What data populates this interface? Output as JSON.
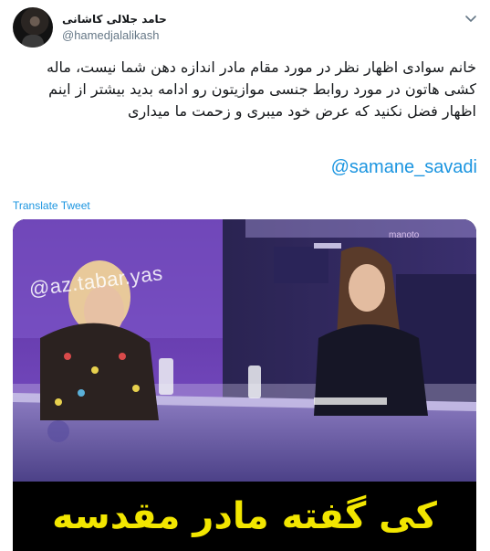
{
  "author": {
    "display_name": "حامد جلالی کاشانی",
    "handle": "@hamedjalalikash",
    "avatar_icon": "user-avatar"
  },
  "tweet": {
    "text": "خانم سوادی اظهار نظر در مورد مقام مادر اندازه دهن شما نیست، ماله کشی هاتون در مورد روابط جنسی موازیتون رو ادامه بدید بیشتر از اینم اظهار فضل نکنید که عرض خود میبری و زحمت ما میداری",
    "mention": "@samane_savadi",
    "translate_label": "Translate Tweet"
  },
  "media": {
    "watermark": "@az.tabar.yas",
    "channel_logo": "manoto",
    "caption": "کی گفته مادر مقدسه"
  },
  "colors": {
    "link": "#1b95e0",
    "caption_text": "#f2e600",
    "studio_purple": "#6a3fb0"
  }
}
